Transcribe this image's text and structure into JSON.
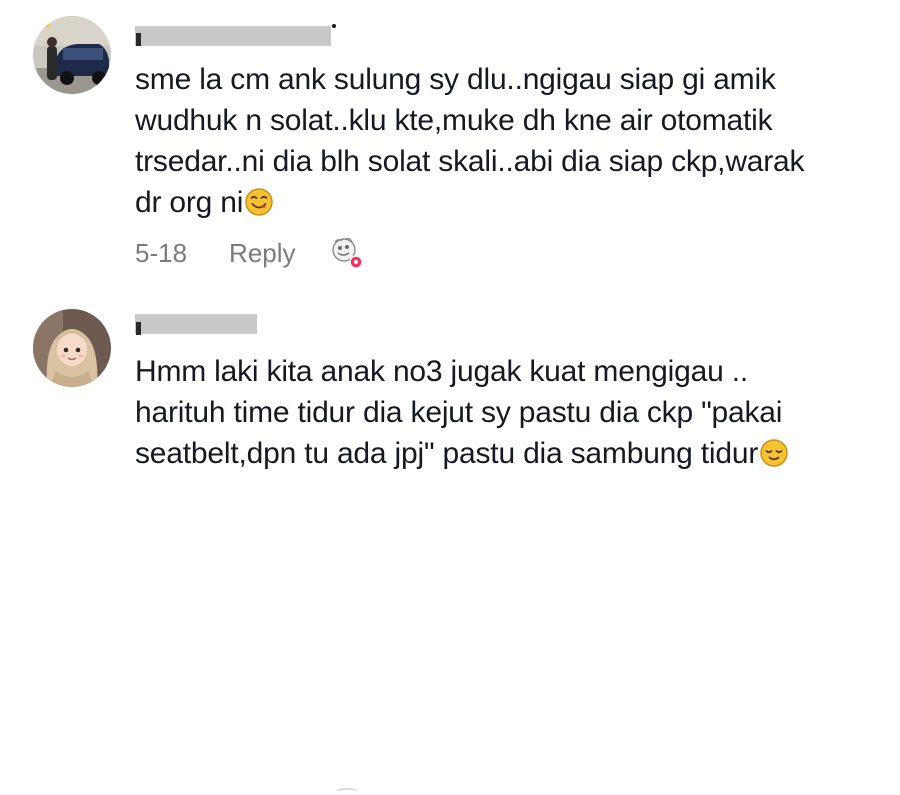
{
  "comments": [
    {
      "avatar_icon": "avatar-photo-person-by-car",
      "text_lines": [
        "sme la cm ank sulung sy dlu..ngigau siap gi amik",
        "wudhuk n solat..klu kte,muke dh kne air otomatik",
        "trsedar..ni dia blh solat skali..abi dia siap ckp,warak",
        "dr org ni"
      ],
      "trailing_emoji": "yum-face-emoji",
      "date": "5-18",
      "reply_label": "Reply",
      "liked_by_creator_icon": "creator-liked-sticker-icon"
    },
    {
      "avatar_icon": "avatar-illustration-hijab-girl",
      "text_lines": [
        "Hmm laki kita anak no3 jugak kuat mengigau ..",
        "harituh time tidur dia kejut sy pastu dia ckp \"pakai",
        "seatbelt,dpn tu ada jpj\" pastu dia sambung tidur"
      ],
      "trailing_emoji": "relieved-face-emoji"
    }
  ],
  "colors": {
    "text": "#161823",
    "meta": "#7a7b80",
    "redaction": "#c8c8c8",
    "like_badge": "#fe2c55"
  }
}
